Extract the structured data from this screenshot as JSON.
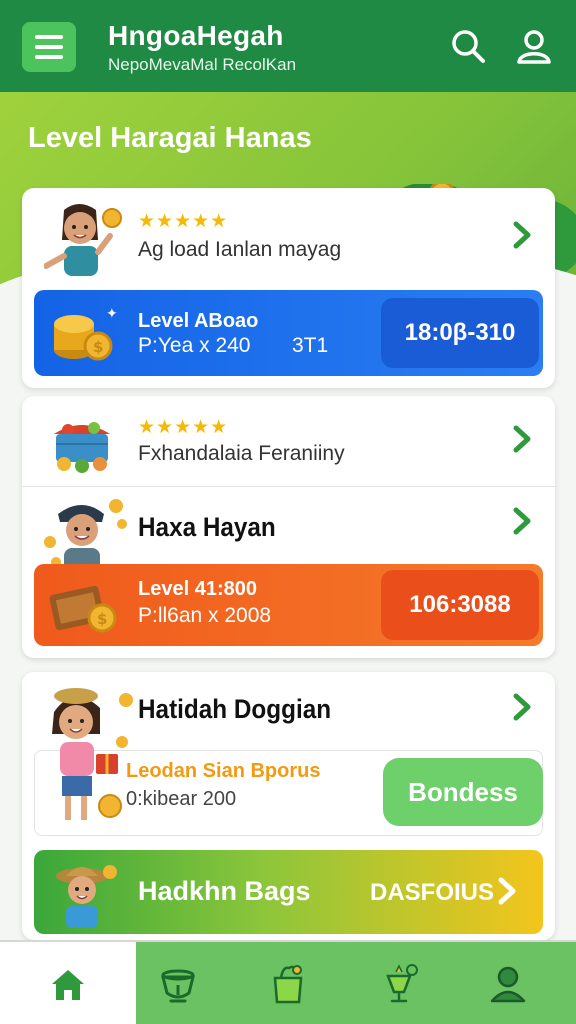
{
  "header": {
    "title": "HngoaHegah",
    "subtitle": "NepoMevaMal RecolKan",
    "menu_icon": "hamburger-menu-icon",
    "search_icon": "search-icon",
    "user_icon": "user-icon"
  },
  "hero": {
    "title": "Level Haragai Hanas"
  },
  "card1": {
    "row": {
      "stars": "★★★★★",
      "text": "Ag load Ianlan mayag"
    },
    "banner": {
      "line1": "Level ABoao",
      "line2": "P:Yea x 240",
      "count": "3T1",
      "pill": "18:0β-310"
    }
  },
  "card2": {
    "row1": {
      "stars": "★★★★★",
      "text": "Fxhandalaia Feraniiny"
    },
    "row2": {
      "title": "Haxa Hayan"
    },
    "banner": {
      "line1": "Level 41:800",
      "line2": "P:ll6an x 2008",
      "pill": "106:3088"
    }
  },
  "card3": {
    "title": "Hatidah Doggian",
    "bonus_title": "Leodan Sian Bporus",
    "bonus_sub": "0:kibear 200",
    "bonus_button": "Bondess",
    "green_banner": {
      "title": "Hadkhn Bags",
      "cta": "DASFOIUS"
    }
  },
  "nav": {
    "items": [
      "home-icon",
      "pot-icon",
      "shopping-bag-icon",
      "trophy-icon",
      "profile-icon"
    ],
    "active": 0
  },
  "colors": {
    "header": "#1e8a43",
    "accent_green": "#4cc35c",
    "star": "#f5b90a",
    "blue_banner": "#1463e6",
    "orange_banner": "#f05a1c",
    "bonus_text": "#f39a12"
  }
}
